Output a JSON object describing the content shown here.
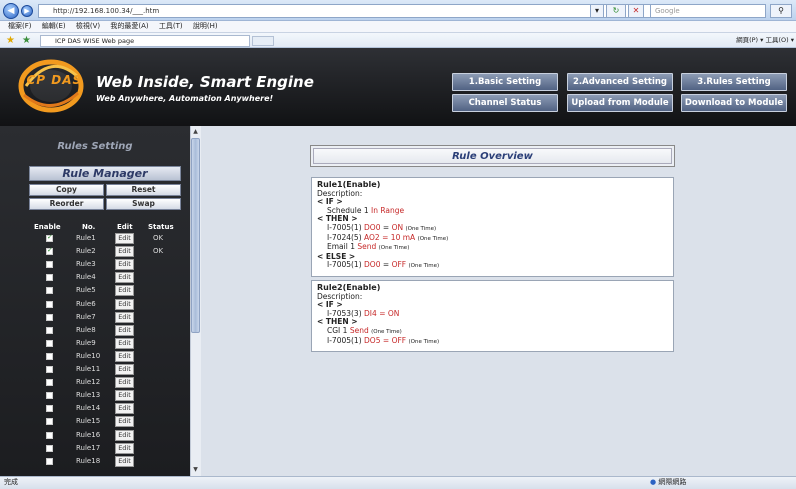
{
  "browser": {
    "url": "http://192.168.100.34/___.htm",
    "search_placeholder": "Google",
    "menu": [
      "檔案(F)",
      "編輯(E)",
      "檢視(V)",
      "我的最愛(A)",
      "工具(T)",
      "說明(H)"
    ],
    "tab_title": "ICP DAS WISE Web page",
    "toolbar_right": "網頁(P) ▾  工具(O) ▾",
    "status_left": "完成",
    "status_right": "網際網路"
  },
  "header": {
    "title": "Web Inside, Smart Engine",
    "subtitle": "Web Anywhere, Automation Anywhere!",
    "logo_text": "ICP DAS",
    "buttons": [
      "1.Basic Setting",
      "2.Advanced Setting",
      "3.Rules Setting",
      "Channel Status",
      "Upload from Module",
      "Download to Module"
    ]
  },
  "sidebar": {
    "section_title": "Rules Setting",
    "manager_title": "Rule Manager",
    "copy_label": "Copy",
    "reset_label": "Reset",
    "reorder_label": "Reorder",
    "swap_label": "Swap",
    "columns": [
      "Enable",
      "No.",
      "Edit",
      "Status"
    ],
    "edit_label": "Edit",
    "rules": [
      {
        "name": "Rule1",
        "enabled": true,
        "status": "OK"
      },
      {
        "name": "Rule2",
        "enabled": true,
        "status": "OK"
      },
      {
        "name": "Rule3",
        "enabled": false,
        "status": ""
      },
      {
        "name": "Rule4",
        "enabled": false,
        "status": ""
      },
      {
        "name": "Rule5",
        "enabled": false,
        "status": ""
      },
      {
        "name": "Rule6",
        "enabled": false,
        "status": ""
      },
      {
        "name": "Rule7",
        "enabled": false,
        "status": ""
      },
      {
        "name": "Rule8",
        "enabled": false,
        "status": ""
      },
      {
        "name": "Rule9",
        "enabled": false,
        "status": ""
      },
      {
        "name": "Rule10",
        "enabled": false,
        "status": ""
      },
      {
        "name": "Rule11",
        "enabled": false,
        "status": ""
      },
      {
        "name": "Rule12",
        "enabled": false,
        "status": ""
      },
      {
        "name": "Rule13",
        "enabled": false,
        "status": ""
      },
      {
        "name": "Rule14",
        "enabled": false,
        "status": ""
      },
      {
        "name": "Rule15",
        "enabled": false,
        "status": ""
      },
      {
        "name": "Rule16",
        "enabled": false,
        "status": ""
      },
      {
        "name": "Rule17",
        "enabled": false,
        "status": ""
      },
      {
        "name": "Rule18",
        "enabled": false,
        "status": ""
      }
    ]
  },
  "overview": {
    "title": "Rule Overview",
    "rule1": {
      "title": "Rule1(Enable)",
      "description": "Description:",
      "if": "< IF >",
      "cond_a": "Schedule 1",
      "cond_b": "In Range",
      "then": "< THEN >",
      "a1_a": "I-7005(1)",
      "a1_b": "DO0",
      "a1_c": "=",
      "a1_d": "ON",
      "a1_e": "(One Time)",
      "a2_a": "I-7024(5)",
      "a2_b": "AO2",
      "a2_c": "=",
      "a2_d": "10 mA",
      "a2_e": "(One Time)",
      "a3_a": "Email 1",
      "a3_b": "Send",
      "a3_c": "(One Time)",
      "else": "< ELSE >",
      "e1_a": "I-7005(1)",
      "e1_b": "DO0",
      "e1_c": "=",
      "e1_d": "OFF",
      "e1_e": "(One Time)"
    },
    "rule2": {
      "title": "Rule2(Enable)",
      "description": "Description:",
      "if": "< IF >",
      "c1_a": "I-7053(3)",
      "c1_b": "DI4",
      "c1_c": "=",
      "c1_d": "ON",
      "then": "< THEN >",
      "a1_a": "CGI 1",
      "a1_b": "Send",
      "a1_c": "(One Time)",
      "a2_a": "I-7005(1)",
      "a2_b": "DO5",
      "a2_c": "=",
      "a2_d": "OFF",
      "a2_e": "(One Time)"
    }
  }
}
